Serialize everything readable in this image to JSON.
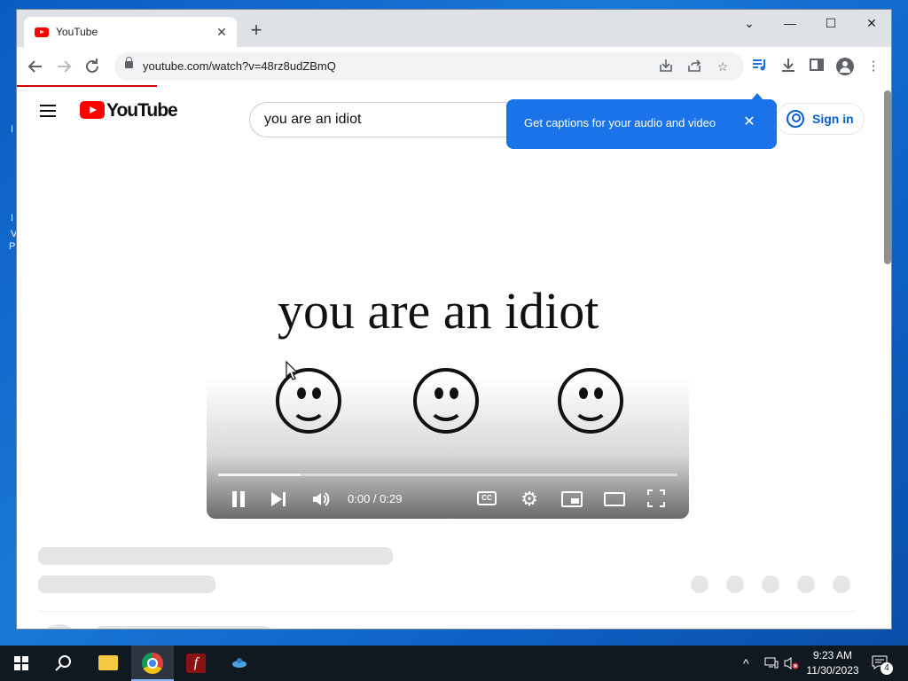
{
  "browser": {
    "tab_title": "YouTube",
    "tab_close": "✕",
    "new_tab": "+",
    "url": "youtube.com/watch?v=48rz8udZBmQ",
    "page_loading_progress": 0.16,
    "window_controls": {
      "tab_search": "⌄",
      "minimize": "—",
      "maximize": "☐",
      "close": "✕"
    }
  },
  "youtube": {
    "logo_text": "YouTube",
    "search_value": "you are an idiot",
    "sign_in_label": "Sign in",
    "captions_tooltip": "Get captions for your audio and video",
    "tooltip_close": "✕"
  },
  "player": {
    "video_caption": "you are an idiot",
    "time": "0:00 / 0:29",
    "cc_label": "CC",
    "progress_loaded": 0.18
  },
  "taskbar": {
    "clock_time": "9:23 AM",
    "clock_date": "11/30/2023",
    "notification_count": "4",
    "flash_glyph": "f"
  },
  "colors": {
    "youtube_red": "#ff0000",
    "tooltip_blue": "#1a73e8",
    "link_blue": "#065fd4"
  }
}
